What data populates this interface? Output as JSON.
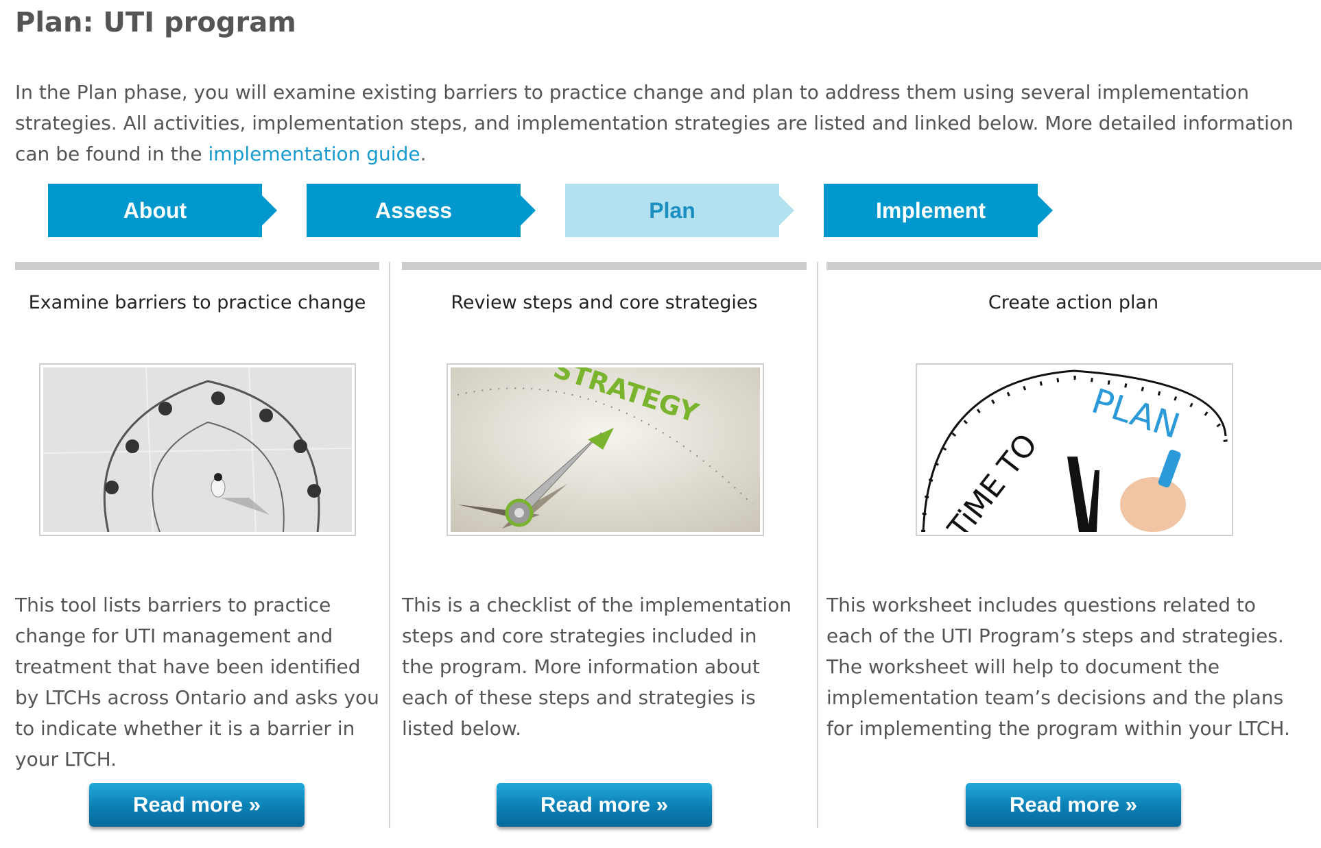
{
  "header": {
    "title": "Plan: UTI program",
    "intro_before_link": "In the Plan phase, you will examine existing barriers to practice change and plan to address them using several implementation strategies. All activities, implementation steps, and implementation strategies are listed and linked below. More detailed information can be found in the ",
    "intro_link": "implementation guide",
    "intro_after_link": "."
  },
  "steps": [
    {
      "label": "About"
    },
    {
      "label": "Assess"
    },
    {
      "label": "Plan",
      "active": true
    },
    {
      "label": "Implement"
    }
  ],
  "columns": [
    {
      "title": "Examine barriers to practice change",
      "image": "person-walking-under-frame-illustration",
      "text": "This tool lists barriers to practice change for UTI management and treatment that have been identified by LTCHs across Ontario and asks you to indicate whether it is a barrier in your LTCH.",
      "button": "Read more »"
    },
    {
      "title": "Review steps and core strategies",
      "image": "strategy-compass-illustration",
      "image_text": "STRATEGY",
      "text": "This is a checklist of the implementation steps and core strategies included in the program. More information about each of these steps and strategies is listed below.",
      "button": "Read more »"
    },
    {
      "title": "Create action plan",
      "image": "time-to-plan-clock-illustration",
      "image_text_1": "TiME TO",
      "image_text_2": "PLAN",
      "text": "This worksheet includes questions related to each of the UTI Program’s steps and strategies. The worksheet will help to document the implementation team’s decisions and the plans for implementing the program within your LTCH.",
      "button": "Read more »"
    }
  ],
  "colors": {
    "step_blue": "#0199cd",
    "step_active": "#b3e1f0",
    "link": "#1a9bd0",
    "button": "#0b7fb4"
  }
}
